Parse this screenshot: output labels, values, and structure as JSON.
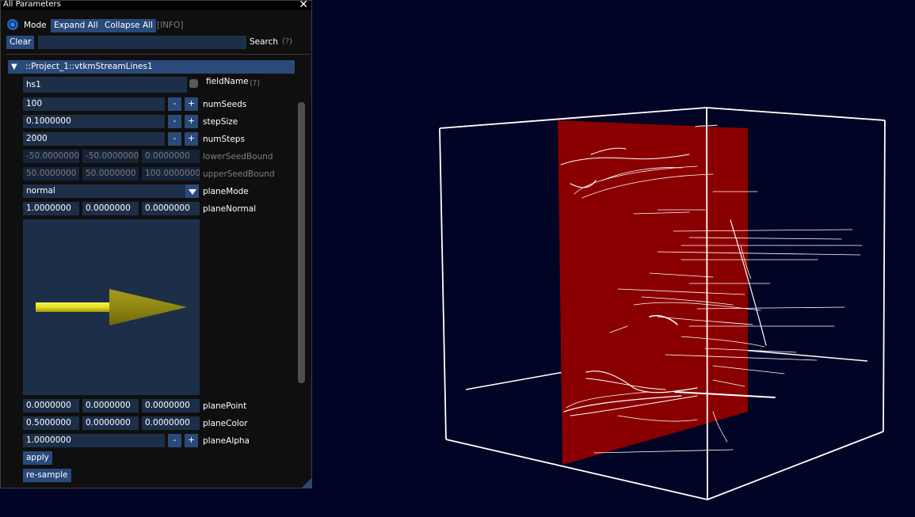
{
  "window": {
    "title": "All Parameters",
    "close_glyph": "✕"
  },
  "toolbar": {
    "mode_label": "Mode",
    "expand_all": "Expand All",
    "collapse_all": "Collapse All",
    "info": "[INFO]"
  },
  "search": {
    "clear": "Clear",
    "value": "",
    "label": "Search",
    "help": "(?)"
  },
  "node": {
    "title": "::Project_1::vtkmStreamLines1",
    "fieldName": {
      "value": "hs1",
      "label": "fieldName",
      "help": "(?)"
    },
    "numSeeds": {
      "value": "100",
      "label": "numSeeds"
    },
    "stepSize": {
      "value": "0.1000000",
      "label": "stepSize"
    },
    "numSteps": {
      "value": "2000",
      "label": "numSteps"
    },
    "lowerSeedBound": {
      "values": [
        "-50.0000000",
        "-50.0000000",
        "0.0000000"
      ],
      "label": "lowerSeedBound"
    },
    "upperSeedBound": {
      "values": [
        "50.0000000",
        "50.0000000",
        "100.0000000"
      ],
      "label": "upperSeedBound"
    },
    "planeMode": {
      "value": "normal",
      "label": "planeMode"
    },
    "planeNormal": {
      "values": [
        "1.0000000",
        "0.0000000",
        "0.0000000"
      ],
      "label": "planeNormal"
    },
    "planePoint": {
      "values": [
        "0.0000000",
        "0.0000000",
        "0.0000000"
      ],
      "label": "planePoint"
    },
    "planeColor": {
      "values": [
        "0.5000000",
        "0.0000000",
        "0.0000000"
      ],
      "label": "planeColor"
    },
    "planeAlpha": {
      "value": "1.0000000",
      "label": "planeAlpha"
    },
    "apply": "apply",
    "resample": "re-sample"
  },
  "stepper": {
    "minus": "-",
    "plus": "+"
  },
  "colors": {
    "background": "#010424",
    "plane": "#8a0000",
    "arrow": "#e5df1b",
    "accent": "#294a7a"
  },
  "icons": {
    "close": "close-icon",
    "tree": "chevron-down-icon",
    "dropdown": "chevron-down-icon"
  }
}
